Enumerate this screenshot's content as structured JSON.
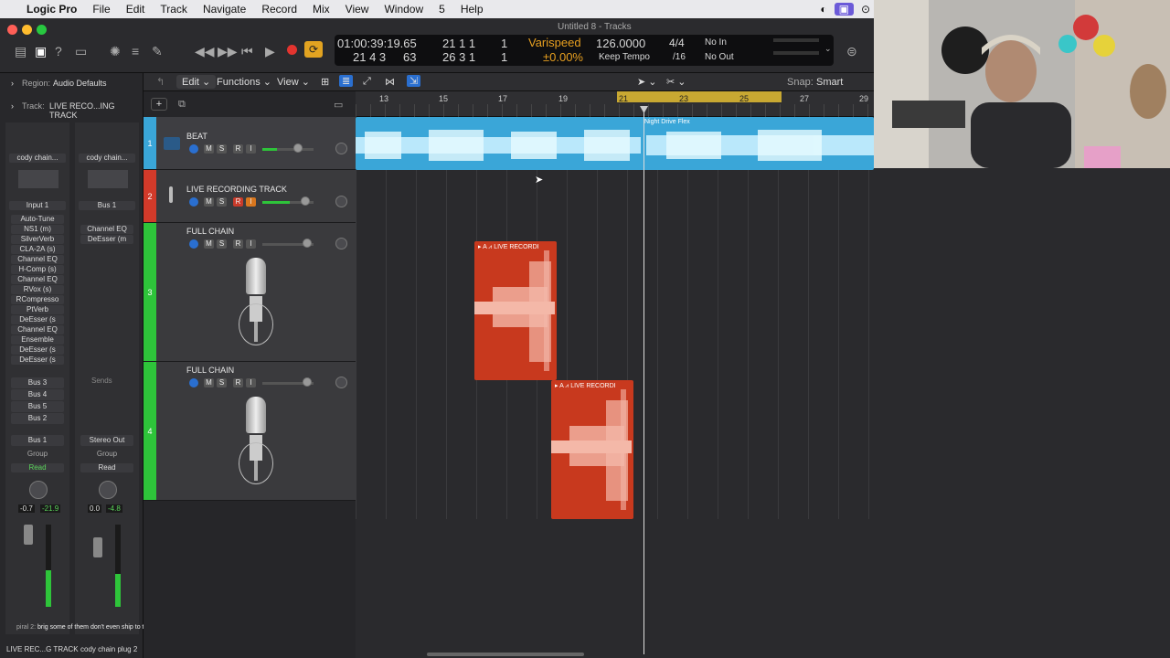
{
  "menubar": {
    "app": "Logic Pro",
    "items": [
      "File",
      "Edit",
      "Track",
      "Navigate",
      "Record",
      "Mix",
      "View",
      "Window",
      "5",
      "Help"
    ]
  },
  "window": {
    "title": "Untitled 8 - Tracks"
  },
  "lcd": {
    "smpte": "01:00:39:19.65",
    "bars_top": "21  1  1",
    "bars_top_tick": "1",
    "bars_bottom_left": "21  4  3",
    "bars_bottom_tick": "63",
    "bars_bottom2": "26  3  1",
    "bars_bottom2_tick": "1",
    "varispeed": "Varispeed",
    "varispeed_val": "±0.00%",
    "tempo": "126.0000",
    "keep_tempo": "Keep Tempo",
    "sig": "4/4",
    "div": "/16",
    "in": "No In",
    "out": "No Out"
  },
  "inspector": {
    "region_label": "Region:",
    "region_value": "Audio Defaults",
    "track_label": "Track:",
    "track_value": "LIVE RECO...ING TRACK",
    "left_strip": {
      "setting": "cody chain...",
      "input": "Input 1",
      "plugins": [
        "Auto-Tune",
        "NS1 (m)",
        "SilverVerb",
        "CLA-2A (s)",
        "Channel EQ",
        "H-Comp (s)",
        "Channel EQ",
        "RVox (s)",
        "RCompresso",
        "PtVerb",
        "DeEsser (s",
        "Channel EQ",
        "Ensemble",
        "DeEsser (s",
        "DeEsser (s"
      ],
      "sends": [
        "Bus 3",
        "Bus 4",
        "Bus 5",
        "Bus 2"
      ],
      "output": "Bus 1",
      "group": "Group",
      "automation": "Read",
      "vol": "-0.7",
      "peak": "-21.9",
      "name": "LIVE REC...G TRACK"
    },
    "right_strip": {
      "setting": "cody chain...",
      "input": "Bus 1",
      "plugins": [
        "Channel EQ",
        "DeEsser (m"
      ],
      "sends_label": "Sends",
      "output": "Stereo Out",
      "group": "Group",
      "automation": "Read",
      "vol": "0.0",
      "peak": "-4.8",
      "name": "cody chain plug 2"
    }
  },
  "tracks_toolbar": {
    "edit": "Edit",
    "functions": "Functions",
    "view": "View",
    "snap_label": "Snap:",
    "snap_value": "Smart"
  },
  "ruler": {
    "bars": [
      "13",
      "15",
      "17",
      "19",
      "21",
      "23",
      "25",
      "27",
      "29"
    ]
  },
  "tracks": [
    {
      "num": "1",
      "name": "BEAT",
      "color": "#3aa6d8"
    },
    {
      "num": "2",
      "name": "LIVE RECORDING TRACK",
      "color": "#d23a2a"
    },
    {
      "num": "3",
      "name": "FULL CHAIN",
      "color": "#2ec43a"
    },
    {
      "num": "4",
      "name": "FULL CHAIN",
      "color": "#2ec43a"
    }
  ],
  "regions": {
    "beat_label": "Night Drive Flex",
    "rec1_label": "LIVE RECORDI",
    "rec2_label": "LIVE RECORDI"
  },
  "subtitle": "brig some of them don't even ship to the uk on zendrop",
  "subtitle_prefix": "piral 2:"
}
